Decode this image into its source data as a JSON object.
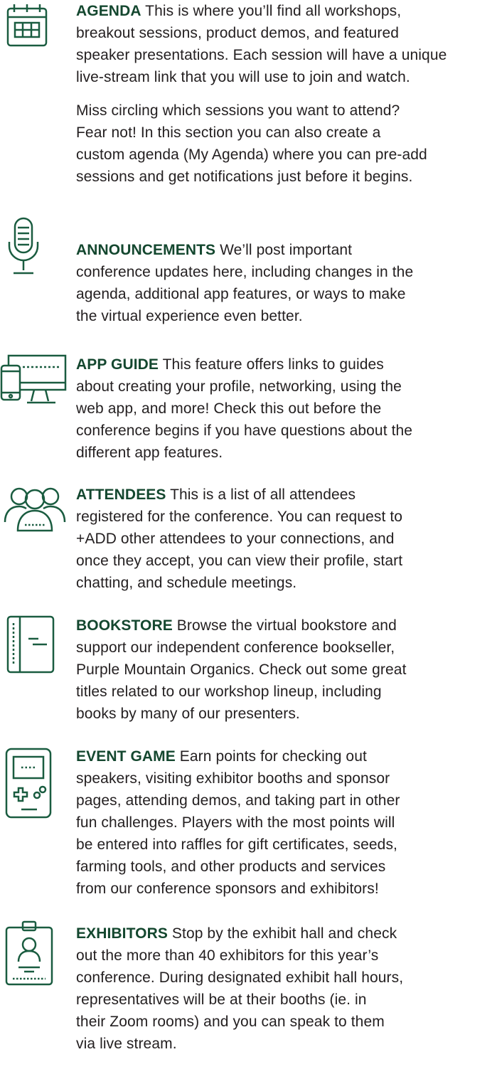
{
  "theme": {
    "heading_color": "#14472f",
    "icon_color": "#1a5c40",
    "text_color": "#231f20"
  },
  "sections": [
    {
      "icon": "calendar-icon",
      "heading": "AGENDA",
      "lines": [
        " This is where you’ll find all workshops,",
        "breakout sessions, product demos, and featured",
        "speaker presentations. Each session will have a unique",
        "live-stream link that you will use to join and watch."
      ],
      "para2": [
        "Miss circling which sessions you want to attend?",
        "Fear not! In this section you can also create a",
        "custom agenda (My Agenda) where you can pre-add",
        "sessions and get notifications just before it begins."
      ]
    },
    {
      "icon": "microphone-icon",
      "heading": "ANNOUNCEMENTS",
      "lines": [
        " We’ll post important",
        "conference updates here, including changes in the",
        "agenda, additional app features, or ways to make",
        "the virtual experience even better."
      ]
    },
    {
      "icon": "devices-icon",
      "heading": "APP GUIDE",
      "lines": [
        " This feature offers links to guides",
        "about creating your profile, networking, using the",
        "web app, and more! Check this out before the",
        "conference begins if you have questions about the",
        "different app features."
      ]
    },
    {
      "icon": "people-icon",
      "heading": "ATTENDEES",
      "lines": [
        " This is a list of all attendees",
        "registered for the conference. You can request to",
        "+ADD other attendees to your connections, and",
        "once they accept, you can view their profile, start",
        "chatting, and schedule meetings."
      ]
    },
    {
      "icon": "book-icon",
      "heading": "BOOKSTORE",
      "lines": [
        " Browse the virtual bookstore and",
        "support our independent conference bookseller,",
        "Purple Mountain Organics. Check out some great",
        "titles related to our workshop lineup, including",
        "books by many of our presenters."
      ]
    },
    {
      "icon": "game-console-icon",
      "heading": "EVENT GAME",
      "lines": [
        " Earn points for checking out",
        "speakers, visiting exhibitor booths and sponsor",
        "pages, attending demos, and taking part in other",
        "fun challenges. Players with the most points will",
        "be entered into raffles for gift certificates, seeds,",
        "farming tools, and other products and services",
        "from our conference sponsors and exhibitors!"
      ]
    },
    {
      "icon": "badge-icon",
      "heading": "EXHIBITORS",
      "lines": [
        " Stop by the exhibit hall and check",
        "out the more than 40 exhibitors for this year’s",
        "conference. During designated exhibit hall hours,",
        "representatives will be at their booths (ie. in",
        "their Zoom rooms) and you can speak to them",
        "via live stream."
      ]
    }
  ]
}
